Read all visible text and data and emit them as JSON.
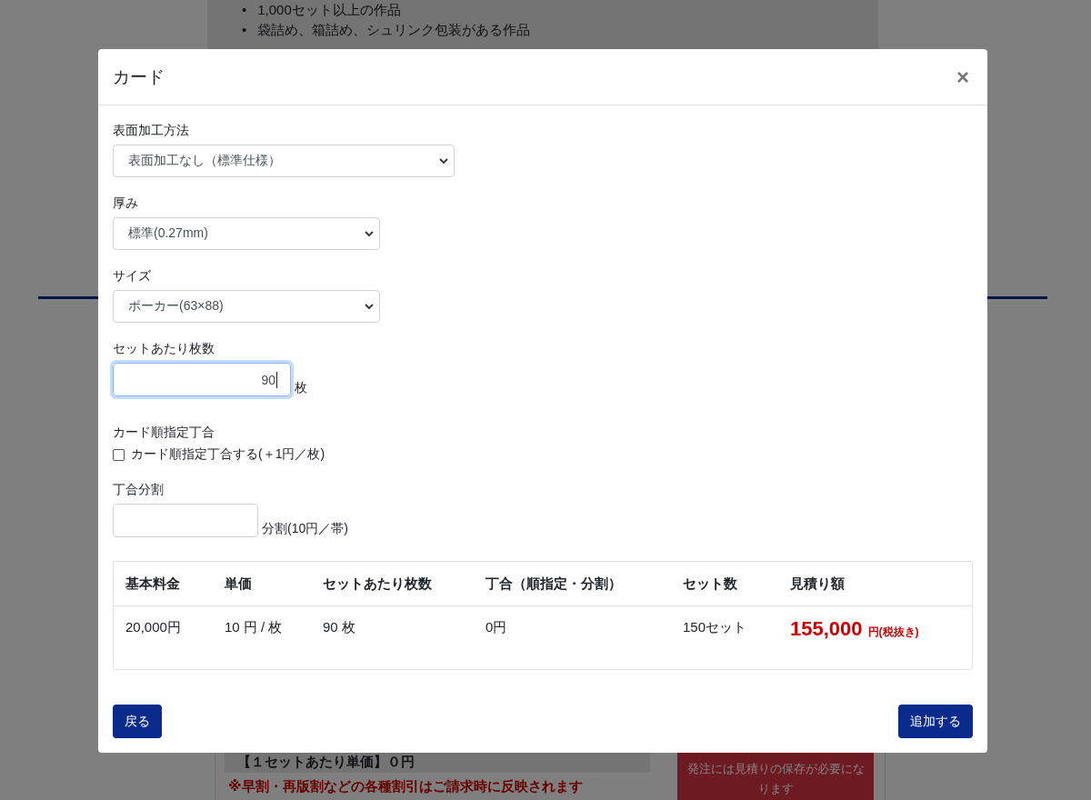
{
  "background": {
    "bullets": [
      {
        "marker": "•",
        "text": "1,000セット以上の作品"
      },
      {
        "marker": "•",
        "text": "袋詰め、箱詰め、シュリンク包装がある作品"
      }
    ],
    "unit_price_label": "【１セットあたり単価】０円",
    "discount_note": "※早割・再版割などの各種割引はご請求時に反映されます",
    "order_button": "発注には見積りの保存が必要になります"
  },
  "modal": {
    "title": "カード",
    "close": "×",
    "fields": [
      {
        "kind": "select",
        "label": "表面加工方法",
        "value": "表面加工なし（標準仕様）"
      },
      {
        "kind": "select",
        "label": "厚み",
        "value": "標準(0.27mm)"
      },
      {
        "kind": "select",
        "label": "サイズ",
        "value": "ポーカー(63×88)"
      },
      {
        "kind": "number",
        "label": "セットあたり枚数",
        "value": "90",
        "unit": "枚",
        "focused": true
      },
      {
        "kind": "checkbox",
        "label": "カード順指定丁合",
        "option": "カード順指定丁合する(＋1円／枚)",
        "checked": false
      },
      {
        "kind": "number",
        "label": "丁合分割",
        "unit": "分割(10円／帯)",
        "focused": false
      }
    ],
    "table": {
      "columns": [
        "基本料金",
        "単価",
        "セットあたり枚数",
        "丁合（順指定・分割）",
        "セット数",
        "見積り額"
      ],
      "row": [
        "20,000円",
        "10 円 / 枚",
        "90 枚",
        "0円",
        "150セット"
      ],
      "total": {
        "amount": "155,000",
        "unit": "円(税抜き)"
      }
    },
    "buttons": {
      "back": "戻る",
      "add": "追加する"
    }
  }
}
